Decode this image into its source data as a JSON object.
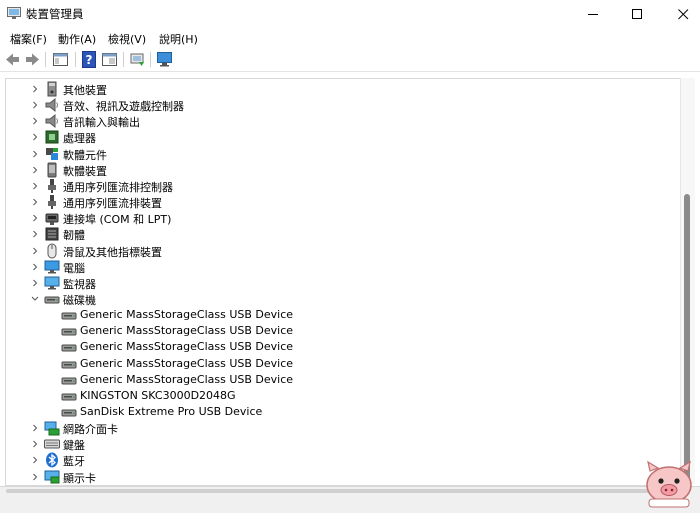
{
  "window": {
    "title": "裝置管理員",
    "minimize_icon": "minimize-icon",
    "maximize_icon": "maximize-icon",
    "close_icon": "close-icon"
  },
  "menu": [
    {
      "label": "檔案(F)"
    },
    {
      "label": "動作(A)"
    },
    {
      "label": "檢視(V)"
    },
    {
      "label": "說明(H)"
    }
  ],
  "toolbar": [
    {
      "icon": "back-arrow-icon"
    },
    {
      "icon": "forward-arrow-icon"
    },
    {
      "icon": "properties-icon"
    },
    {
      "icon": "help-icon"
    },
    {
      "icon": "view-resources-icon"
    },
    {
      "icon": "update-driver-icon"
    },
    {
      "icon": "scan-hardware-icon"
    }
  ],
  "tree": [
    {
      "label": "其他裝置",
      "icon": "unknown-device-icon",
      "expanded": false
    },
    {
      "label": "音效、視訊及遊戲控制器",
      "icon": "speaker-icon",
      "expanded": false
    },
    {
      "label": "音訊輸入與輸出",
      "icon": "speaker-icon",
      "expanded": false
    },
    {
      "label": "處理器",
      "icon": "cpu-icon",
      "expanded": false
    },
    {
      "label": "軟體元件",
      "icon": "software-component-icon",
      "expanded": false
    },
    {
      "label": "軟體裝置",
      "icon": "software-device-icon",
      "expanded": false
    },
    {
      "label": "通用序列匯流排控制器",
      "icon": "usb-icon",
      "expanded": false
    },
    {
      "label": "通用序列匯流排裝置",
      "icon": "usb-icon",
      "expanded": false
    },
    {
      "label": "連接埠 (COM 和 LPT)",
      "icon": "port-icon",
      "expanded": false
    },
    {
      "label": "韌體",
      "icon": "firmware-icon",
      "expanded": false
    },
    {
      "label": "滑鼠及其他指標裝置",
      "icon": "mouse-icon",
      "expanded": false
    },
    {
      "label": "電腦",
      "icon": "computer-icon",
      "expanded": false
    },
    {
      "label": "監視器",
      "icon": "monitor-icon",
      "expanded": false
    },
    {
      "label": "磁碟機",
      "icon": "disk-drive-icon",
      "expanded": true
    },
    {
      "label": "Generic MassStorageClass USB Device",
      "icon": "disk-drive-icon",
      "child": true
    },
    {
      "label": "Generic MassStorageClass USB Device",
      "icon": "disk-drive-icon",
      "child": true
    },
    {
      "label": "Generic MassStorageClass USB Device",
      "icon": "disk-drive-icon",
      "child": true
    },
    {
      "label": "Generic MassStorageClass USB Device",
      "icon": "disk-drive-icon",
      "child": true
    },
    {
      "label": "Generic MassStorageClass USB Device",
      "icon": "disk-drive-icon",
      "child": true
    },
    {
      "label": "KINGSTON SKC3000D2048G",
      "icon": "disk-drive-icon",
      "child": true
    },
    {
      "label": "SanDisk Extreme Pro USB Device",
      "icon": "disk-drive-icon",
      "child": true
    },
    {
      "label": "網路介面卡",
      "icon": "network-adapter-icon",
      "expanded": false
    },
    {
      "label": "鍵盤",
      "icon": "keyboard-icon",
      "expanded": false
    },
    {
      "label": "藍牙",
      "icon": "bluetooth-icon",
      "expanded": false
    },
    {
      "label": "顯示卡",
      "icon": "display-adapter-icon",
      "expanded": false
    }
  ],
  "colors": {
    "accent": "#0078d4",
    "scroll_thumb": "#8b8b8b",
    "bluetooth": "#1f6fd0"
  }
}
